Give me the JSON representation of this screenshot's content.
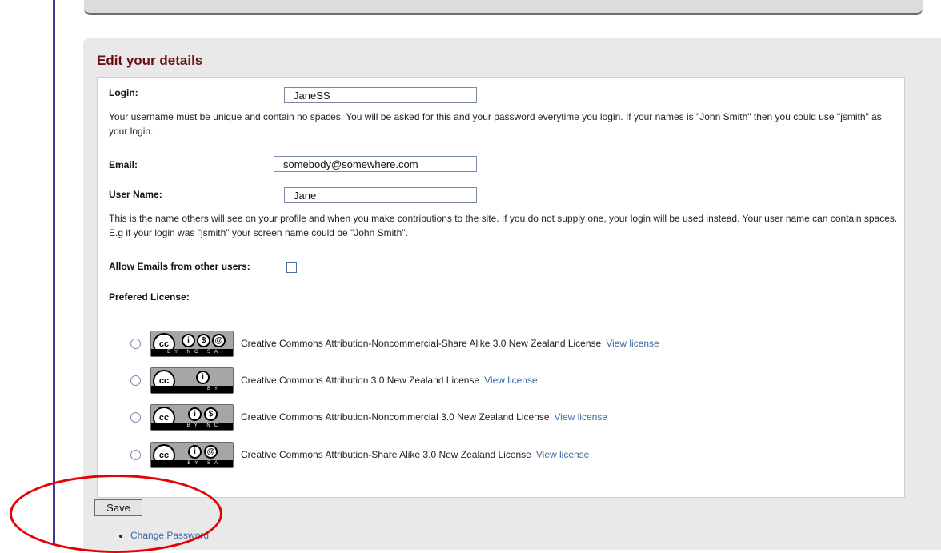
{
  "page": {
    "title": "Edit your details"
  },
  "form": {
    "login_label": "Login:",
    "login_value": "JaneSS",
    "login_help": "Your username must be unique and contain no spaces. You will be asked for this and your password everytime you login. If your names is \"John Smith\" then you could use \"jsmith\" as your login.",
    "email_label": "Email:",
    "email_value": "somebody@somewhere.com",
    "username_label": "User Name:",
    "username_value": "Jane",
    "username_help": "This is the name others will see on your profile and when you make contributions to the site. If you do not supply one, your login will be used instead. Your user name can contain spaces. E.g if your login was \"jsmith\" your screen name could be \"John Smith\".",
    "allow_emails_label": "Allow Emails from other users:",
    "allow_emails_checked": false,
    "license_label": "Prefered License:"
  },
  "licenses": [
    {
      "name": "Creative Commons Attribution-Noncommercial-Share Alike 3.0 New Zealand License",
      "link": "View license",
      "badge_text": "BY NC SA",
      "icons": [
        "cc-icon",
        "by-icon",
        "nc-icon",
        "sa-icon"
      ]
    },
    {
      "name": "Creative Commons Attribution 3.0 New Zealand License",
      "link": "View license",
      "badge_text": "BY",
      "icons": [
        "cc-icon",
        "by-icon"
      ]
    },
    {
      "name": "Creative Commons Attribution-Noncommercial 3.0 New Zealand License",
      "link": "View license",
      "badge_text": "BY NC",
      "icons": [
        "cc-icon",
        "by-icon",
        "nc-icon"
      ]
    },
    {
      "name": "Creative Commons Attribution-Share Alike 3.0 New Zealand License",
      "link": "View license",
      "badge_text": "BY SA",
      "icons": [
        "cc-icon",
        "by-icon",
        "sa-icon"
      ]
    }
  ],
  "actions": {
    "save_label": "Save",
    "change_password_label": "Change Password"
  },
  "colors": {
    "title": "#6d0f12",
    "link": "#3b6aa0",
    "frame": "#3a3a96",
    "highlight": "#e60000"
  }
}
